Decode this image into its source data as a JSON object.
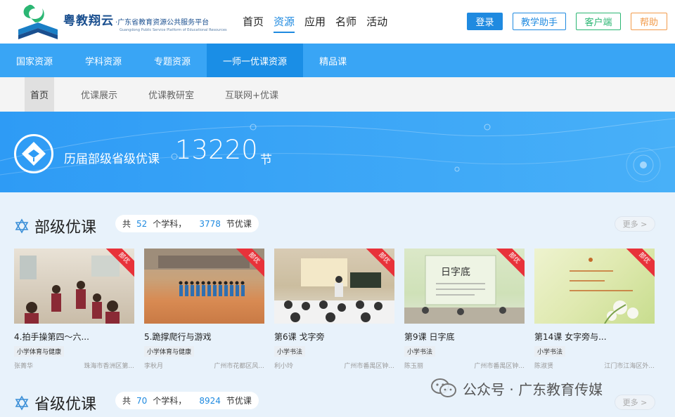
{
  "header": {
    "logo_cn": "粤教翔云",
    "logo_sub": "·广东省教育资源公共服务平台",
    "logo_en": "Guangdong Public Service Platform of Educational Resources",
    "nav": [
      "首页",
      "资源",
      "应用",
      "名师",
      "活动"
    ],
    "nav_active": "资源",
    "login": "登录",
    "assistant": "教学助手",
    "client": "客户端",
    "help": "帮助"
  },
  "navbar": [
    "国家资源",
    "学科资源",
    "专题资源",
    "一师一优课资源",
    "精品课"
  ],
  "navbar_active": "一师一优课资源",
  "subnav": [
    "首页",
    "优课展示",
    "优课教研室",
    "互联网+优课"
  ],
  "subnav_active": "首页",
  "banner": {
    "label": "历届部级省级优课",
    "count": "13220",
    "unit": "节"
  },
  "section1": {
    "title": "部级优课",
    "stat_prefix": "共",
    "subjects": "52",
    "subjects_unit": "个学科，",
    "lessons": "3778",
    "lessons_unit": "节优课",
    "more": "更多 >"
  },
  "section2": {
    "title": "省级优课",
    "stat_prefix": "共",
    "subjects": "70",
    "subjects_unit": "个学科，",
    "lessons": "8924",
    "lessons_unit": "节优课",
    "more": "更多 >"
  },
  "ribbon_label": "部优",
  "cards": [
    {
      "title": "4.拍手操第四～六...",
      "tag": "小学体育与健康",
      "teacher": "张菁华",
      "school": "珠海市香洲区第..."
    },
    {
      "title": "5.跪撑爬行与游戏",
      "tag": "小学体育与健康",
      "teacher": "李秋月",
      "school": "广州市花都区风..."
    },
    {
      "title": "第6课 戈字旁",
      "tag": "小学书法",
      "teacher": "利小玲",
      "school": "广州市番禺区钟..."
    },
    {
      "title": "第9课 日字底",
      "tag": "小学书法",
      "teacher": "陈玉丽",
      "school": "广州市番禺区钟..."
    },
    {
      "title": "第14课 女字旁与...",
      "tag": "小学书法",
      "teacher": "陈淑贤",
      "school": "江门市江海区外..."
    }
  ],
  "watermark": "公众号 · 广东教育传媒",
  "colors": {
    "accent": "#1f8ae0",
    "navbar": "#39a5f5",
    "ribbon": "#e8323a"
  }
}
